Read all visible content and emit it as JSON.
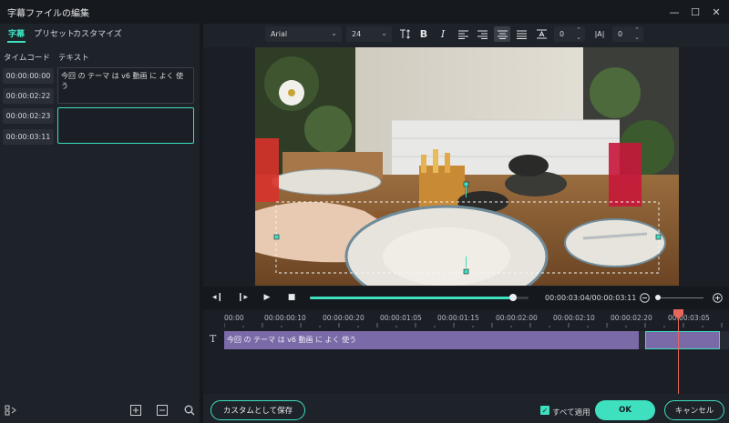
{
  "window": {
    "title": "字幕ファイルの編集",
    "minimize": "—",
    "maximize": "☐",
    "close": "✕"
  },
  "tabs": [
    {
      "label": "字幕"
    },
    {
      "label": "プリセット"
    },
    {
      "label": "カスタマイズ"
    }
  ],
  "columns": {
    "timecode": "タイムコード",
    "text": "テキスト"
  },
  "subtitles": [
    {
      "start": "00:00:00:00",
      "end": "00:00:02:22",
      "text": "今回 の テーマ は v6 動画 に よく 使う"
    },
    {
      "start": "00:00:02:23",
      "end": "00:00:03:11",
      "text": ""
    }
  ],
  "toolbar": {
    "font": "Arial",
    "size": "24",
    "spacing_value": "0",
    "line_value": "0"
  },
  "playback": {
    "time": "00:00:03:04/00:00:03:11",
    "progress": 0.93
  },
  "ruler": [
    "00:00",
    "00:00:00:10",
    "00:00:00:20",
    "00:00:01:05",
    "00:00:01:15",
    "00:00:02:00",
    "00:00:02:10",
    "00:00:02:20",
    "00:00:03:05"
  ],
  "timeline": {
    "track_icon": "T",
    "clip1_text": "今回 の テーマ は v6 動画 に よく 使う"
  },
  "footer": {
    "save_custom": "カスタムとして保存",
    "apply_all": "すべて適用",
    "ok": "OK",
    "cancel": "キャンセル"
  },
  "colors": {
    "accent": "#3ee0bf",
    "playhead": "#e8665c",
    "clip": "#7b6aa8"
  }
}
